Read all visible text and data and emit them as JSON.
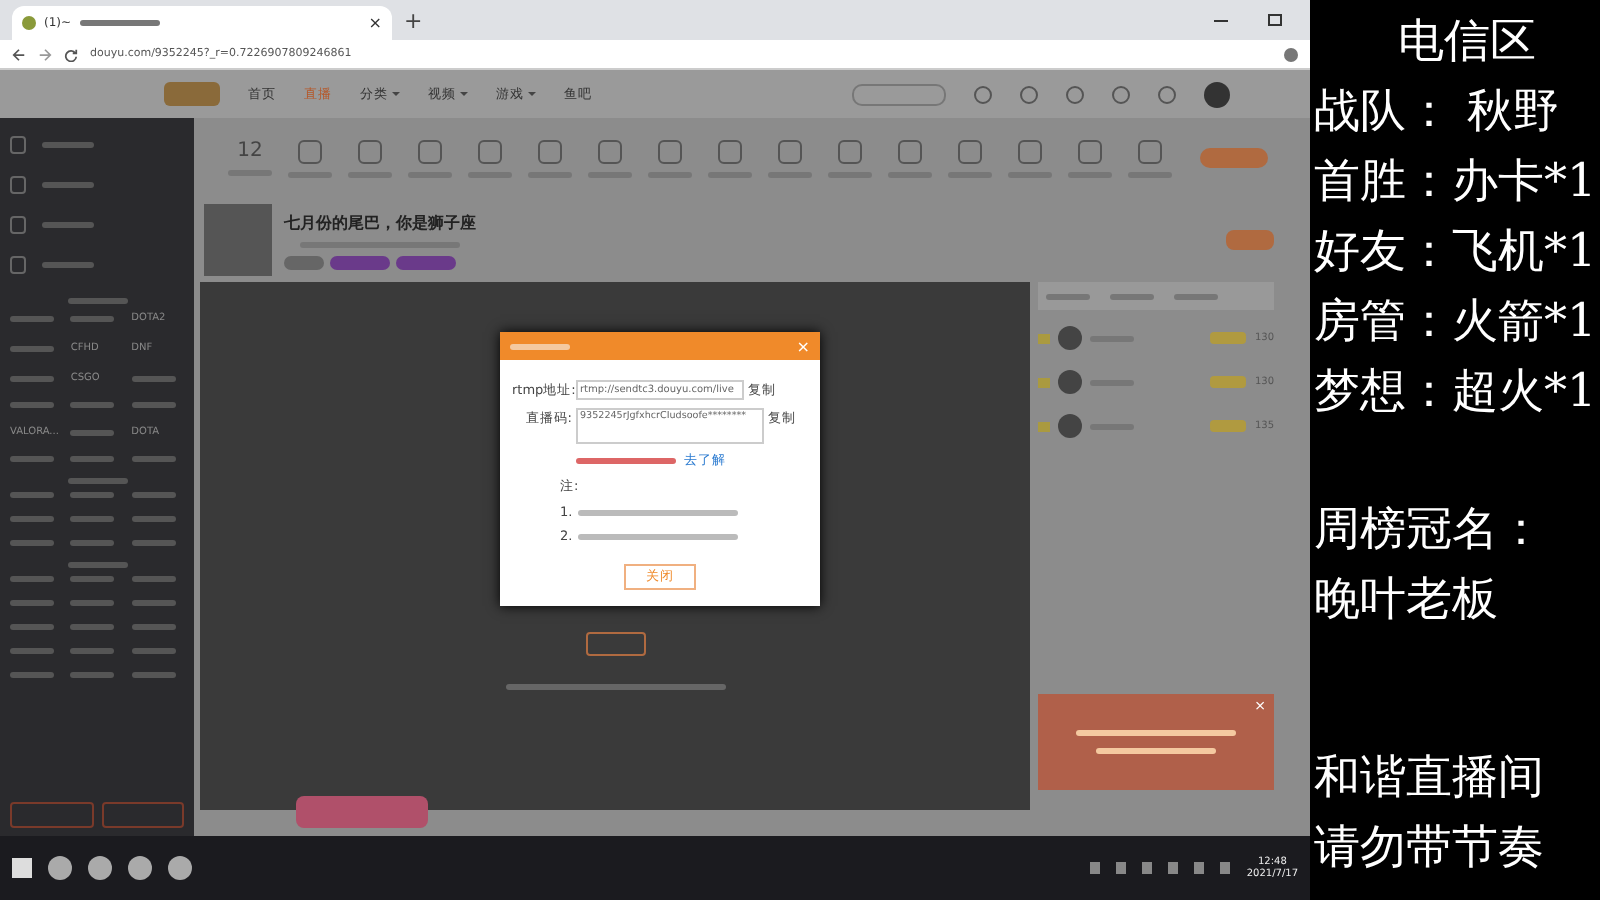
{
  "browser": {
    "tab_title": "(1)~",
    "tab_close": "×",
    "new_tab": "+",
    "url": "douyu.com/9352245?_r=0.7226907809246861"
  },
  "nav": [
    {
      "label": "首页",
      "selected": false,
      "kind": "plain"
    },
    {
      "label": "直播",
      "selected": true,
      "kind": "plain"
    },
    {
      "label": "分类",
      "selected": false,
      "kind": "menu"
    },
    {
      "label": "视频",
      "selected": false,
      "kind": "menu"
    },
    {
      "label": "游戏",
      "selected": false,
      "kind": "menu"
    },
    {
      "label": "鱼吧",
      "selected": false,
      "kind": "plain"
    }
  ],
  "toolbar": {
    "count": "12"
  },
  "room": {
    "title": "七月份的尾巴，你是狮子座"
  },
  "sidebar": {
    "sections": [
      {
        "cells": [
          {
            "kind": "blur"
          },
          {
            "kind": "blur"
          },
          {
            "kind": "text",
            "text": "DOTA2"
          },
          {
            "kind": "blur"
          },
          {
            "kind": "text",
            "text": "CFHD"
          },
          {
            "kind": "text",
            "text": "DNF"
          },
          {
            "kind": "blur"
          },
          {
            "kind": "text",
            "text": "CSGO"
          },
          {
            "kind": "blur"
          },
          {
            "kind": "blur"
          },
          {
            "kind": "blur"
          },
          {
            "kind": "blur"
          },
          {
            "kind": "text",
            "text": "VALORA..."
          },
          {
            "kind": "blur"
          },
          {
            "kind": "text",
            "text": "DOTA"
          },
          {
            "kind": "blur"
          },
          {
            "kind": "blur"
          },
          {
            "kind": "blur"
          }
        ]
      },
      {
        "cells": [
          {
            "kind": "blur"
          },
          {
            "kind": "blur"
          },
          {
            "kind": "blur"
          },
          {
            "kind": "blur"
          },
          {
            "kind": "blur"
          },
          {
            "kind": "blur"
          },
          {
            "kind": "blur"
          },
          {
            "kind": "blur"
          },
          {
            "kind": "blur"
          }
        ]
      },
      {
        "cells": [
          {
            "kind": "blur"
          },
          {
            "kind": "blur"
          },
          {
            "kind": "blur"
          },
          {
            "kind": "blur"
          },
          {
            "kind": "blur"
          },
          {
            "kind": "blur"
          },
          {
            "kind": "blur"
          },
          {
            "kind": "blur"
          },
          {
            "kind": "blur"
          },
          {
            "kind": "blur"
          },
          {
            "kind": "blur"
          },
          {
            "kind": "blur"
          },
          {
            "kind": "blur"
          },
          {
            "kind": "blur"
          },
          {
            "kind": "blur"
          }
        ]
      }
    ]
  },
  "dialog": {
    "close": "×",
    "fields": [
      {
        "label": "rtmp地址:",
        "value": "rtmp://sendtc3.douyu.com/live",
        "action": "复制"
      },
      {
        "label": "直播码:",
        "value": "9352245rJgfxhcrCIudsoofe********",
        "action": "复制"
      }
    ],
    "link": "去了解",
    "notes_heading": "注:",
    "notes": [
      "1.",
      "2."
    ],
    "button": "关闭"
  },
  "ranking": [
    {
      "score": "130"
    },
    {
      "score": "130"
    },
    {
      "score": "135"
    }
  ],
  "promo": {
    "close": "×"
  },
  "overlay": {
    "blocks": [
      [
        "电信区",
        "战队： 秋野",
        "首胜：办卡*1",
        "好友：飞机*1",
        "房管：火箭*1",
        "梦想：超火*1"
      ],
      [
        "周榜冠名：",
        "晚叶老板"
      ],
      [
        "和谐直播间",
        "请勿带节奏"
      ]
    ]
  },
  "taskbar": {
    "time": "12:48",
    "date": "2021/7/17"
  }
}
